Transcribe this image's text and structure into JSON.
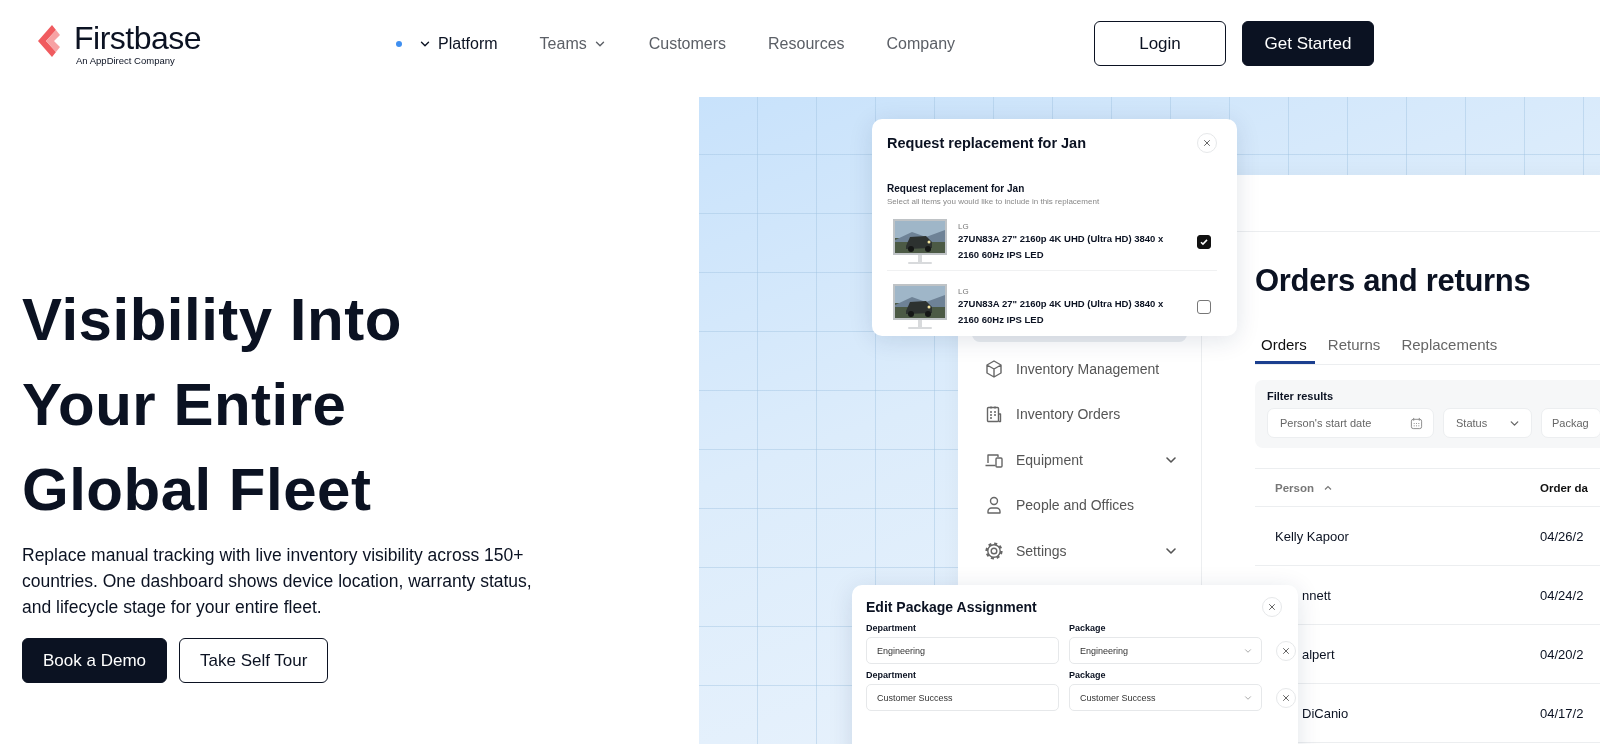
{
  "header": {
    "logo": {
      "name": "Firstbase",
      "tagline": "An AppDirect Company"
    },
    "nav": [
      {
        "label": "Platform",
        "selected": true,
        "kind": "dropdown"
      },
      {
        "label": "Teams",
        "selected": false,
        "kind": "dropdown"
      },
      {
        "label": "Customers",
        "selected": false
      },
      {
        "label": "Resources",
        "selected": false
      },
      {
        "label": "Company",
        "selected": false
      }
    ],
    "buttons": [
      {
        "label": "Login",
        "kind": "outline"
      },
      {
        "label": "Get Started",
        "kind": "primary"
      }
    ]
  },
  "hero": {
    "title_lines": [
      "Visibility Into",
      "Your Entire",
      "Global Fleet"
    ],
    "text": "Replace manual tracking with live inventory visibility across 150+ countries. One dashboard shows device location, warranty status, and lifecycle stage for your entire fleet.",
    "buttons": [
      {
        "label": "Book a Demo",
        "kind": "primary"
      },
      {
        "label": "Take Self Tour",
        "kind": "outline"
      }
    ]
  },
  "app": {
    "sidebar": [
      {
        "label": "Inventory Management",
        "expandable": false
      },
      {
        "label": "Inventory Orders",
        "expandable": false
      },
      {
        "label": "Equipment",
        "expandable": true
      },
      {
        "label": "People and Offices",
        "expandable": false
      },
      {
        "label": "Settings",
        "expandable": true
      }
    ],
    "title": "Orders and returns",
    "tabs": [
      {
        "label": "Orders",
        "selected": true
      },
      {
        "label": "Returns",
        "selected": false
      },
      {
        "label": "Replacements",
        "selected": false
      }
    ],
    "filter_label": "Filter results",
    "filters": [
      {
        "label": "Person's start date",
        "kind": "date"
      },
      {
        "label": "Status",
        "kind": "select"
      },
      {
        "label": "Packag",
        "kind": "plain"
      }
    ],
    "columns": [
      {
        "label": "Person",
        "sorted": true
      },
      {
        "label": "Order da",
        "sorted": false
      }
    ],
    "rows": [
      [
        "Kelly Kapoor",
        "04/26/2"
      ],
      [
        "nnett",
        "04/24/2"
      ],
      [
        "alpert",
        "04/20/2"
      ],
      [
        "DiCanio",
        "04/17/2"
      ]
    ]
  },
  "replacement_dialog": {
    "title": "Request replacement for Jan",
    "heading": "Request replacement for Jan",
    "description": "Select all items you would like to include in this replacement",
    "items": [
      {
        "brand": "LG",
        "name": "27UN83A 27\" 2160p 4K UHD (Ultra HD) 3840 x 2160 60Hz IPS LED",
        "checked": true
      },
      {
        "brand": "LG",
        "name": "27UN83A 27\" 2160p 4K UHD (Ultra HD) 3840 x 2160 60Hz IPS LED",
        "checked": false
      }
    ]
  },
  "package_dialog": {
    "title": "Edit Package Assignment",
    "rows": [
      {
        "department_label": "Department",
        "department": "Engineering",
        "package_label": "Package",
        "package": "Engineering"
      },
      {
        "department_label": "Department",
        "department": "Customer Success",
        "package_label": "Package",
        "package": "Customer Success"
      }
    ]
  }
}
